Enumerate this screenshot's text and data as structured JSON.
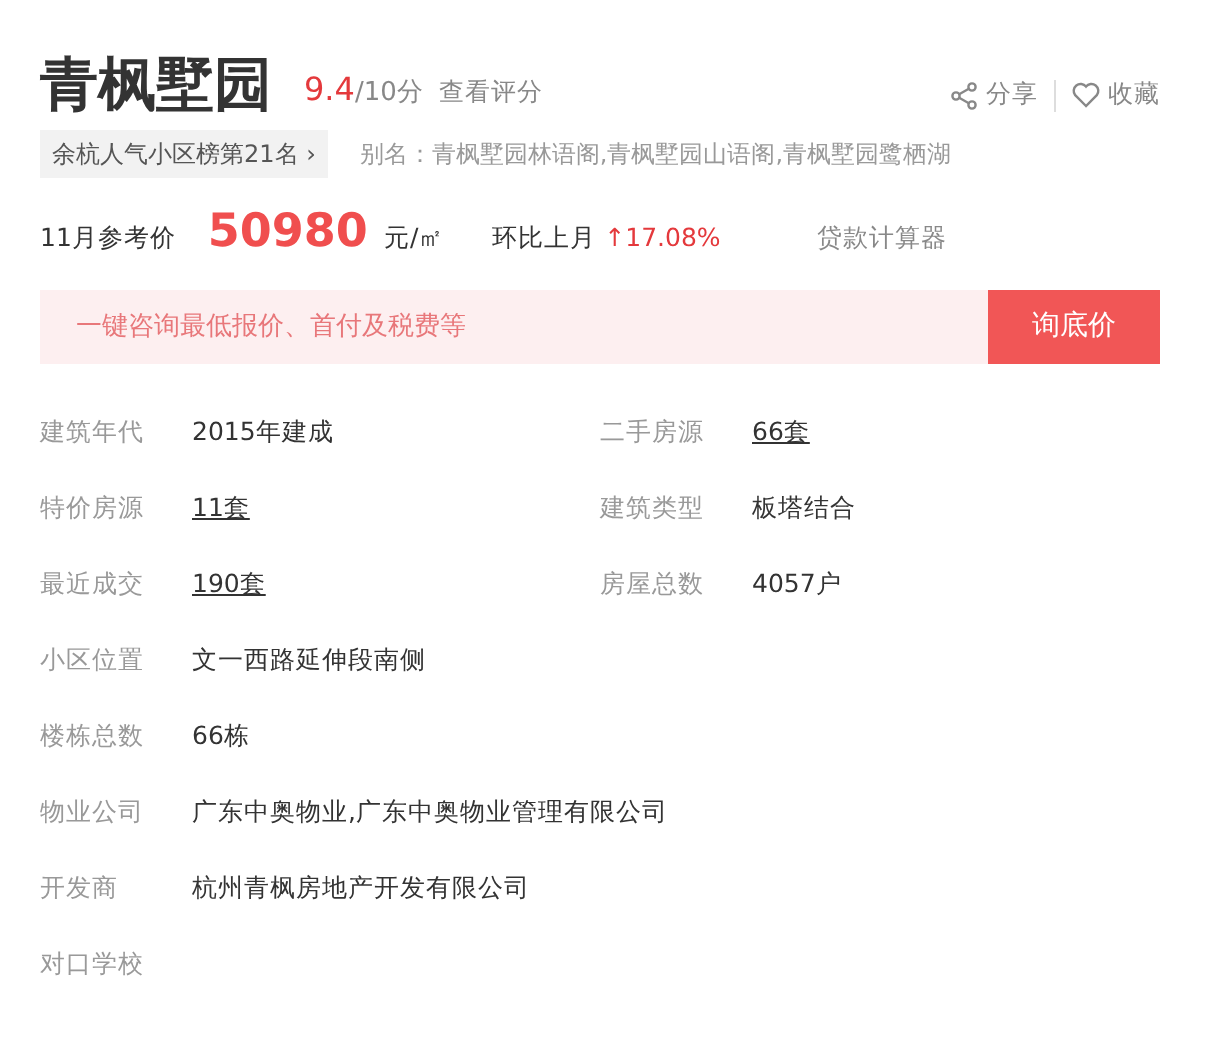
{
  "title": "青枫墅园",
  "rating": {
    "score": "9.4",
    "scale": "/10分",
    "link": "查看评分"
  },
  "actions": [
    {
      "kind": "share",
      "label": "分享"
    },
    {
      "kind": "favorite",
      "label": "收藏"
    }
  ],
  "rank_tag": {
    "label": "余杭人气小区榜第21名",
    "chevron": "›"
  },
  "alias": "别名：青枫墅园林语阁,青枫墅园山语阁,青枫墅园鹭栖湖",
  "price": {
    "label": "11月参考价",
    "value": "50980",
    "unit": "元/㎡",
    "change_label": "环比上月",
    "change": "↑17.08%",
    "calculator": "贷款计算器"
  },
  "consult": {
    "placeholder": "一键咨询最低报价、首付及税费等",
    "button": "询底价"
  },
  "info_rows": [
    [
      {
        "label": "建筑年代",
        "value": "2015年建成",
        "link": false
      },
      {
        "label": "二手房源",
        "value": "66套",
        "link": true
      }
    ],
    [
      {
        "label": "特价房源",
        "value": "11套",
        "link": true
      },
      {
        "label": "建筑类型",
        "value": "板塔结合",
        "link": false
      }
    ],
    [
      {
        "label": "最近成交",
        "value": "190套",
        "link": true
      },
      {
        "label": "房屋总数",
        "value": "4057户",
        "link": false
      }
    ],
    [
      {
        "label": "小区位置",
        "value": "文一西路延伸段南侧",
        "link": false
      }
    ],
    [
      {
        "label": "楼栋总数",
        "value": "66栋",
        "link": false
      }
    ],
    [
      {
        "label": "物业公司",
        "value": "广东中奥物业,广东中奥物业管理有限公司",
        "link": false
      }
    ],
    [
      {
        "label": "开发商",
        "value": "杭州青枫房地产开发有限公司",
        "link": false
      }
    ],
    [
      {
        "label": "对口学校"
      }
    ]
  ]
}
